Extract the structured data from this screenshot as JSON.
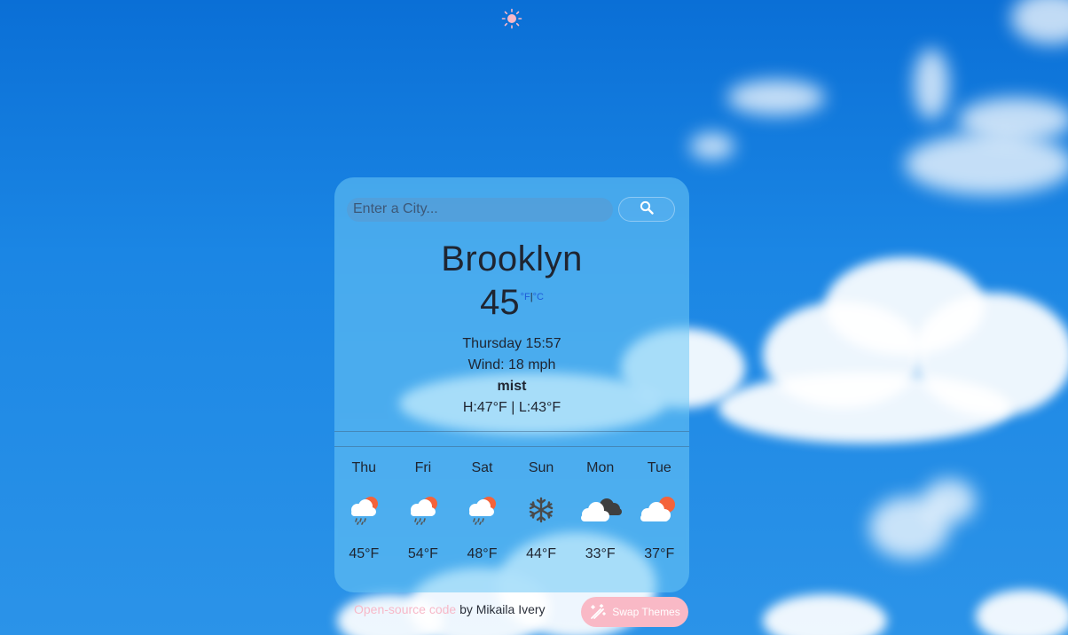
{
  "theme_toggle": {
    "icon": "sun-icon",
    "color": "#f7b8c8"
  },
  "search": {
    "placeholder": "Enter a City...",
    "value": "",
    "button_icon": "search-icon"
  },
  "current": {
    "city": "Brooklyn",
    "temperature": "45",
    "unit_f": "°F",
    "unit_separator": "|",
    "unit_c": "°C",
    "datetime": "Thursday 15:57",
    "wind": "Wind: 18 mph",
    "description": "mist",
    "high_low": "H:47°F | L:43°F"
  },
  "forecast": [
    {
      "day": "Thu",
      "icon": "rain-cloud-sun-icon",
      "temp": "45°F"
    },
    {
      "day": "Fri",
      "icon": "rain-cloud-sun-icon",
      "temp": "54°F"
    },
    {
      "day": "Sat",
      "icon": "rain-cloud-sun-icon",
      "temp": "48°F"
    },
    {
      "day": "Sun",
      "icon": "snowflake-icon",
      "temp": "44°F"
    },
    {
      "day": "Mon",
      "icon": "clouds-icon",
      "temp": "33°F"
    },
    {
      "day": "Tue",
      "icon": "cloud-sun-icon",
      "temp": "37°F"
    }
  ],
  "footer": {
    "link_text": "Open-source code",
    "byline": " by Mikaila Ivery",
    "swap_label": "Swap Themes",
    "swap_icon": "magic-wand-icon"
  },
  "colors": {
    "accent_pink": "#f9b9c6",
    "unit_link": "#1f5dd9"
  }
}
